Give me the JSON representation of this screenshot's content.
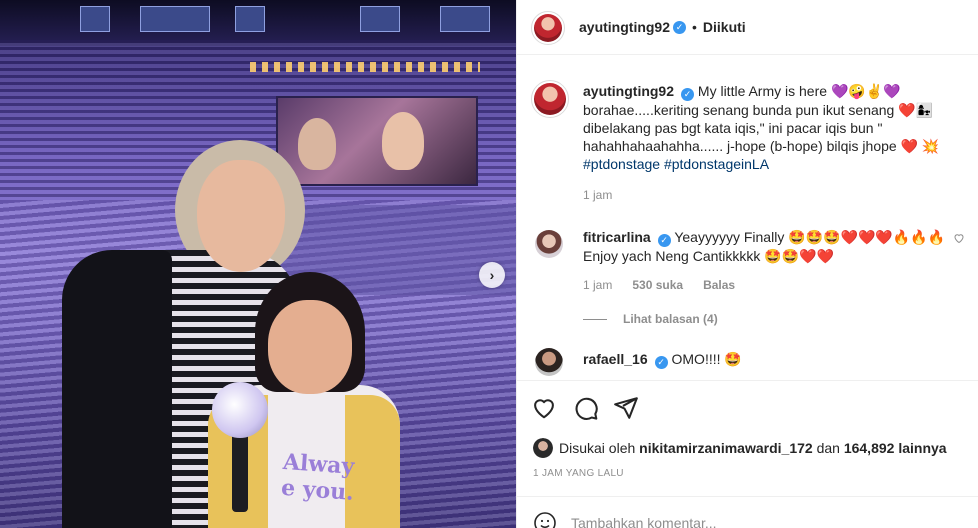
{
  "post": {
    "author": "ayutingting92",
    "follow_status": "Diikuti",
    "header_dot": "•",
    "next_arrow": "›"
  },
  "photo": {
    "shirt_line1": "Alway",
    "shirt_line2": "e you."
  },
  "caption": {
    "username": "ayutingting92",
    "line1": "My little Army is here",
    "line1_emoji": "💜🤪✌️💜",
    "line2": "borahae.....keriting senang bunda pun ikut senang",
    "line2_emoji": "❤️👩‍👧",
    "line3": "dibelakang pas bgt kata iqis,\" ini pacar iqis bun \"",
    "line4": "hahahhahaahahha...... j-hope (b-hope) bilqis jhope",
    "line4_emoji": "❤️ 💥",
    "hashtag1": "#ptdonstage",
    "hashtag2": "#ptdonstageinLA",
    "time": "1 jam"
  },
  "comments": [
    {
      "username": "fitricarlina",
      "text": "Yeayyyyyy Finally",
      "emoji": "🤩🤩🤩❤️❤️❤️🔥🔥🔥",
      "text2": "Enjoy yach Neng Cantikkkkk",
      "emoji2": "🤩🤩❤️❤️",
      "time": "1 jam",
      "likes": "530 suka",
      "reply": "Balas",
      "view_replies": "Lihat balasan (4)"
    },
    {
      "username": "rafaell_16",
      "text": "OMO!!!!",
      "emoji": "🤩"
    }
  ],
  "likes": {
    "prefix": "Disukai oleh",
    "user": "nikitamirzanimawardi_172",
    "middle": "dan",
    "count": "164,892 lainnya"
  },
  "timestamp": "1 JAM YANG LALU",
  "add_comment": {
    "placeholder": "Tambahkan komentar..."
  },
  "verified_mark": "✓"
}
